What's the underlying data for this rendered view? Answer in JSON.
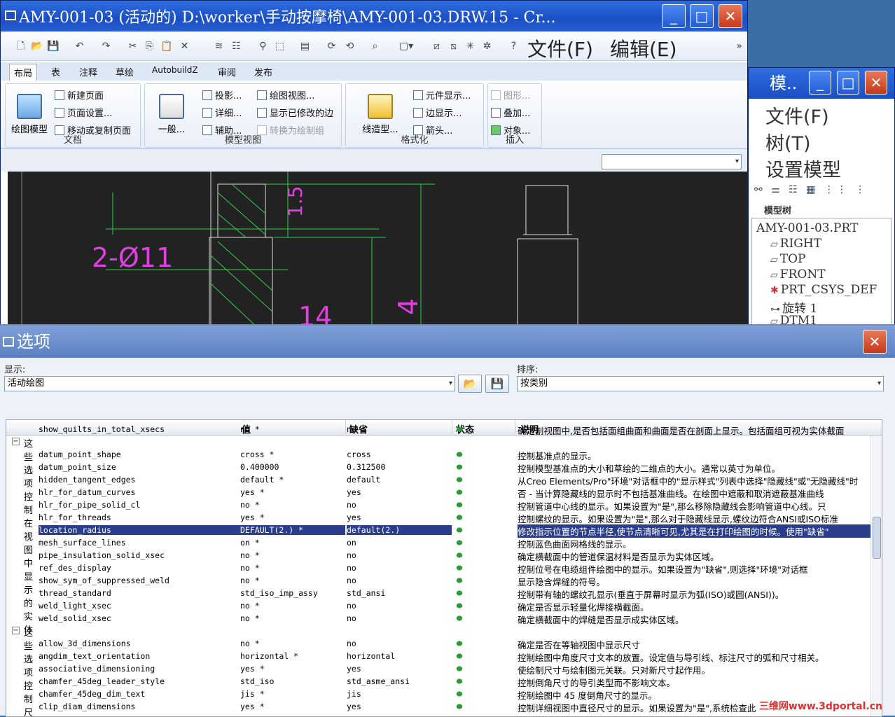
{
  "main_window": {
    "title": "AMY-001-03 (活动的) D:\\worker\\手动按摩椅\\AMY-001-03.DRW.15 - Cr...",
    "menu_file": "文件(F)",
    "menu_edit": "编辑(E)",
    "overflow": "»",
    "tabs": [
      "布局",
      "表",
      "注释",
      "草绘",
      "AutobuildZ",
      "审阅",
      "发布"
    ],
    "ribbon": {
      "doc_group": "文档",
      "drawing_model": "绘图模型",
      "new_page": "新建页面",
      "page_setup": "页面设置...",
      "move_copy_page": "移动或复制页面",
      "model_view_group": "模型视图",
      "general": "一般...",
      "projection": "投影...",
      "detail": "详细...",
      "auxiliary": "辅助...",
      "drawing_view": "绘图视图...",
      "show_modified_edges": "显示已修改的边",
      "convert_to_draw_group": "转换为绘制组",
      "format_group": "格式化",
      "line_style": "线造型...",
      "component_display": "元件显示...",
      "edge_display": "边显示...",
      "arrow": "箭头...",
      "insert_group": "插入",
      "graph": "图形...",
      "overlay": "叠加...",
      "object": "对象..."
    },
    "drawing_dims": {
      "d1": "2-Ø11",
      "d2": "14",
      "d3": "4",
      "d4": "1.5"
    }
  },
  "tree_window": {
    "title": "模..",
    "menu_file": "文件(F)",
    "menu_tree": "树(T)",
    "menu_setup": "设置模型",
    "header": "模型树",
    "nodes": [
      "AMY-001-03.PRT",
      "RIGHT",
      "TOP",
      "FRONT",
      "PRT_CSYS_DEF",
      "旋转 1",
      "DTM1"
    ]
  },
  "options_dialog": {
    "title": "选项",
    "show_label": "显示:",
    "show_value": "活动绘图",
    "sort_label": "排序:",
    "sort_value": "按类别",
    "columns": {
      "value": "值",
      "default": "缺省",
      "status": "状态",
      "desc": "说明"
    },
    "partial_row": {
      "name": "show_quilts_in_total_xsecs",
      "value": "no *",
      "default": "no",
      "desc": "确定剖视图中,是否包括面组曲面和曲面是否在剖面上显示。包括面组可视为实体截面"
    },
    "group1": "这些选项控制在视图中显示的实体",
    "group2": "这些选项控制尺寸",
    "rows": [
      {
        "name": "datum_point_shape",
        "value": "cross *",
        "default": "cross",
        "desc": "控制基准点的显示。"
      },
      {
        "name": "datum_point_size",
        "value": "0.400000",
        "default": "0.312500",
        "desc": "控制模型基准点的大小和草绘的二维点的大小。通常以英寸为单位。"
      },
      {
        "name": "hidden_tangent_edges",
        "value": "default *",
        "default": "default",
        "desc": "从Creo Elements/Pro\"环境\"对话框中的\"显示样式\"列表中选择\"隐藏线\"或\"无隐藏线\"时"
      },
      {
        "name": "hlr_for_datum_curves",
        "value": "yes *",
        "default": "yes",
        "desc": "否 - 当计算隐藏线的显示时不包括基准曲线。在绘图中遮蔽和取消遮蔽基准曲线"
      },
      {
        "name": "hlr_for_pipe_solid_cl",
        "value": "no *",
        "default": "no",
        "desc": "控制管道中心线的显示。如果设置为\"是\",那么移除隐藏线会影响管道中心线。只"
      },
      {
        "name": "hlr_for_threads",
        "value": "yes *",
        "default": "yes",
        "desc": "控制螺纹的显示。如果设置为\"是\",那么对于隐藏线显示,螺纹边符合ANSI或ISO标准"
      },
      {
        "name": "location_radius",
        "value": "DEFAULT(2.) *",
        "default": "default(2.)",
        "desc": "修改指示位置的节点半径,使节点清晰可见,尤其是在打印绘图的时候。使用\"缺省\"",
        "selected": true
      },
      {
        "name": "mesh_surface_lines",
        "value": "on *",
        "default": "on",
        "desc": "控制蓝色曲面网格线的显示。"
      },
      {
        "name": "pipe_insulation_solid_xsec",
        "value": "no *",
        "default": "no",
        "desc": "确定横截面中的管道保温材料是否显示为实体区域。"
      },
      {
        "name": "ref_des_display",
        "value": "no *",
        "default": "no",
        "desc": "控制位号在电缆组件绘图中的显示。如果设置为\"缺省\",则选择\"环境\"对话框"
      },
      {
        "name": "show_sym_of_suppressed_weld",
        "value": "no *",
        "default": "no",
        "desc": "显示隐含焊缝的符号。"
      },
      {
        "name": "thread_standard",
        "value": "std_iso_imp_assy",
        "default": "std_ansi",
        "desc": "控制带有轴的螺纹孔显示(垂直于屏幕时显示为弧(ISO)或圆(ANSI))。"
      },
      {
        "name": "weld_light_xsec",
        "value": "no *",
        "default": "no",
        "desc": "确定是否显示轻量化焊接横截面。"
      },
      {
        "name": "weld_solid_xsec",
        "value": "no *",
        "default": "no",
        "desc": "确定横截面中的焊缝是否显示成实体区域。"
      },
      {
        "name": "allow_3d_dimensions",
        "value": "no *",
        "default": "no",
        "desc": "确定是否在等轴视图中显示尺寸"
      },
      {
        "name": "angdim_text_orientation",
        "value": "horizontal *",
        "default": "horizontal",
        "desc": "控制绘图中角度尺寸文本的放置。设定值与导引线、标注尺寸的弧和尺寸相关。"
      },
      {
        "name": "associative_dimensioning",
        "value": "yes *",
        "default": "yes",
        "desc": "使绘制尺寸与绘制图元关联。只对新尺寸起作用。"
      },
      {
        "name": "chamfer_45deg_leader_style",
        "value": "std_iso",
        "default": "std_asme_ansi",
        "desc": "控制倒角尺寸的导引类型而不影响文本。"
      },
      {
        "name": "chamfer_45deg_dim_text",
        "value": "jis *",
        "default": "jis",
        "desc": "控制绘图中 45 度倒角尺寸的显示。"
      },
      {
        "name": "clip_diam_dimensions",
        "value": "yes *",
        "default": "yes",
        "desc": "控制详细视图中直径尺寸的显示。如果设置为\"是\",系统检查此"
      }
    ],
    "watermark": "三维网www.3dportal.cn"
  }
}
